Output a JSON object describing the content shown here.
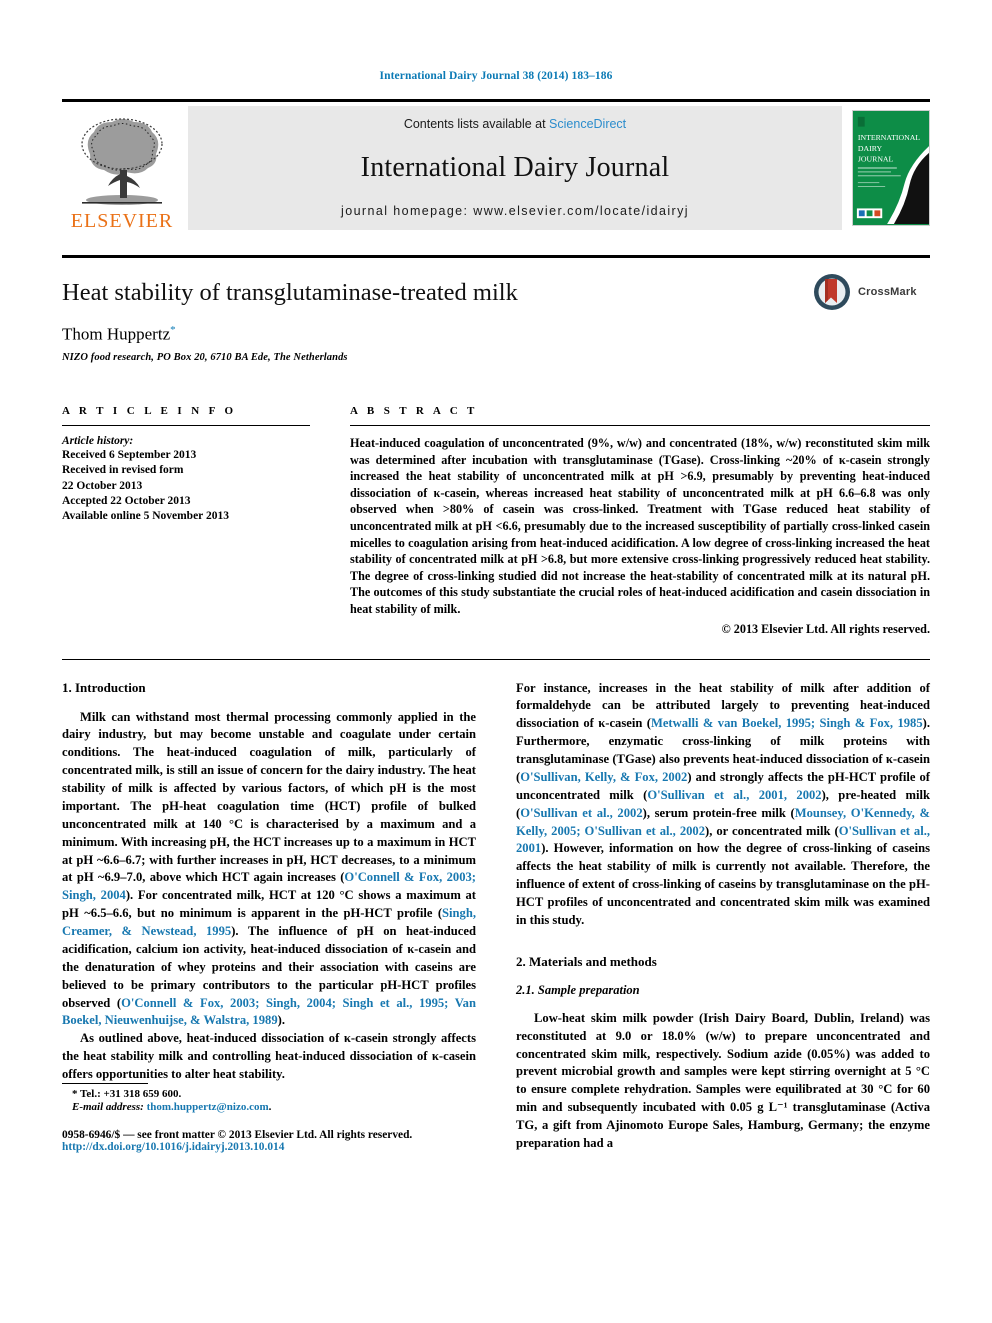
{
  "running_head": "International Dairy Journal 38 (2014) 183–186",
  "masthead": {
    "publisher_name": "ELSEVIER",
    "contents_prefix": "Contents lists available at ",
    "contents_link": "ScienceDirect",
    "journal_name": "International Dairy Journal",
    "homepage_line": "journal homepage: www.elsevier.com/locate/idairyj",
    "cover": {
      "line1": "INTERNATIONAL",
      "line2": "DAIRY",
      "line3": "JOURNAL",
      "bg_color": "#0d8d47"
    }
  },
  "article": {
    "title": "Heat stability of transglutaminase-treated milk",
    "author": "Thom Huppertz",
    "author_marker": "*",
    "affiliation": "NIZO food research, PO Box 20, 6710 BA Ede, The Netherlands",
    "crossmark_label": "CrossMark"
  },
  "article_info": {
    "heading": "A R T I C L E   I N F O",
    "history_label": "Article history:",
    "history": [
      "Received 6 September 2013",
      "Received in revised form",
      "22 October 2013",
      "Accepted 22 October 2013",
      "Available online 5 November 2013"
    ]
  },
  "abstract": {
    "heading": "A B S T R A C T",
    "text": "Heat-induced coagulation of unconcentrated (9%, w/w) and concentrated (18%, w/w) reconstituted skim milk was determined after incubation with transglutaminase (TGase). Cross-linking ~20% of κ-casein strongly increased the heat stability of unconcentrated milk at pH >6.9, presumably by preventing heat-induced dissociation of κ-casein, whereas increased heat stability of unconcentrated milk at pH 6.6–6.8 was only observed when >80% of casein was cross-linked. Treatment with TGase reduced heat stability of unconcentrated milk at pH <6.6, presumably due to the increased susceptibility of partially cross-linked casein micelles to coagulation arising from heat-induced acidification. A low degree of cross-linking increased the heat stability of concentrated milk at pH >6.8, but more extensive cross-linking progressively reduced heat stability. The degree of cross-linking studied did not increase the heat-stability of concentrated milk at its natural pH. The outcomes of this study substantiate the crucial roles of heat-induced acidification and casein dissociation in heat stability of milk.",
    "copyright": "© 2013 Elsevier Ltd. All rights reserved."
  },
  "sections": {
    "introduction_heading": "1.  Introduction",
    "intro_p1_a": "Milk can withstand most thermal processing commonly applied in the dairy industry, but may become unstable and coagulate under certain conditions. The heat-induced coagulation of milk, particularly of concentrated milk, is still an issue of concern for the dairy industry. The heat stability of milk is affected by various factors, of which pH is the most important. The pH-heat coagulation time (HCT) profile of bulked unconcentrated milk at 140 °C is characterised by a maximum and a minimum. With increasing pH, the HCT increases up to a maximum in HCT at pH ~6.6–6.7; with further increases in pH, HCT decreases, to a minimum at pH ~6.9–7.0, above which HCT again increases (",
    "intro_p1_cite1": "O'Connell & Fox, 2003; Singh, 2004",
    "intro_p1_b": "). For concentrated milk, HCT at 120 °C shows a maximum at pH ~6.5–6.6, but no minimum is apparent in the pH-HCT profile (",
    "intro_p1_cite2": "Singh, Creamer, & Newstead, 1995",
    "intro_p1_c": "). The influence of pH on heat-induced acidification, calcium ion activity, heat-induced dissociation of κ-casein and the denaturation of whey proteins and their association with caseins are believed to be primary contributors to the particular pH-HCT profiles observed (",
    "intro_p1_cite3": "O'Connell & Fox, 2003; Singh, 2004; Singh et al., 1995; Van Boekel, Nieuwenhuijse, & Walstra, 1989",
    "intro_p1_d": ").",
    "intro_p2": "As outlined above, heat-induced dissociation of κ-casein strongly affects the heat stability milk and controlling heat-induced dissociation of κ-casein offers opportunities to alter heat stability.",
    "intro_p3_a": "For instance, increases in the heat stability of milk after addition of formaldehyde can be attributed largely to preventing heat-induced dissociation of κ-casein (",
    "intro_p3_cite1": "Metwalli & van Boekel, 1995; Singh & Fox, 1985",
    "intro_p3_b": "). Furthermore, enzymatic cross-linking of milk proteins with transglutaminase (TGase) also prevents heat-induced dissociation of κ-casein (",
    "intro_p3_cite2": "O'Sullivan, Kelly, & Fox, 2002",
    "intro_p3_c": ") and strongly affects the pH-HCT profile of unconcentrated milk (",
    "intro_p3_cite3": "O'Sullivan et al., 2001, 2002",
    "intro_p3_d": "), pre-heated milk (",
    "intro_p3_cite4": "O'Sullivan et al., 2002",
    "intro_p3_e": "), serum protein-free milk (",
    "intro_p3_cite5": "Mounsey, O'Kennedy, & Kelly, 2005; O'Sullivan et al., 2002",
    "intro_p3_f": "), or concentrated milk (",
    "intro_p3_cite6": "O'Sullivan et al., 2001",
    "intro_p3_g": "). However, information on how the degree of cross-linking of caseins affects the heat stability of milk is currently not available. Therefore, the influence of extent of cross-linking of caseins by transglutaminase on the pH-HCT profiles of unconcentrated and concentrated skim milk was examined in this study.",
    "materials_heading": "2.  Materials and methods",
    "sample_prep_heading": "2.1.  Sample preparation",
    "sample_prep_p1": "Low-heat skim milk powder (Irish Dairy Board, Dublin, Ireland) was reconstituted at 9.0 or 18.0% (w/w) to prepare unconcentrated and concentrated skim milk, respectively. Sodium azide (0.05%) was added to prevent microbial growth and samples were kept stirring overnight at 5 °C to ensure complete rehydration. Samples were equilibrated at 30 °C for 60 min and subsequently incubated with 0.05 g L⁻¹ transglutaminase (Activa TG, a gift from Ajinomoto Europe Sales, Hamburg, Germany; the enzyme preparation had a"
  },
  "footnotes": {
    "tel": "* Tel.: +31 318 659 600.",
    "email_label": "E-mail address:",
    "email": "thom.huppertz@nizo.com",
    "email_suffix": ".",
    "issn_line": "0958-6946/$ — see front matter © 2013 Elsevier Ltd. All rights reserved.",
    "doi_line": "http://dx.doi.org/10.1016/j.idairyj.2013.10.014"
  },
  "colors": {
    "link_blue": "#1878b0",
    "header_blue": "#0b7ab5",
    "elsevier_orange": "#ea7117",
    "sciencedirect_blue": "#2b8ccc",
    "cover_green": "#0d8d47"
  }
}
